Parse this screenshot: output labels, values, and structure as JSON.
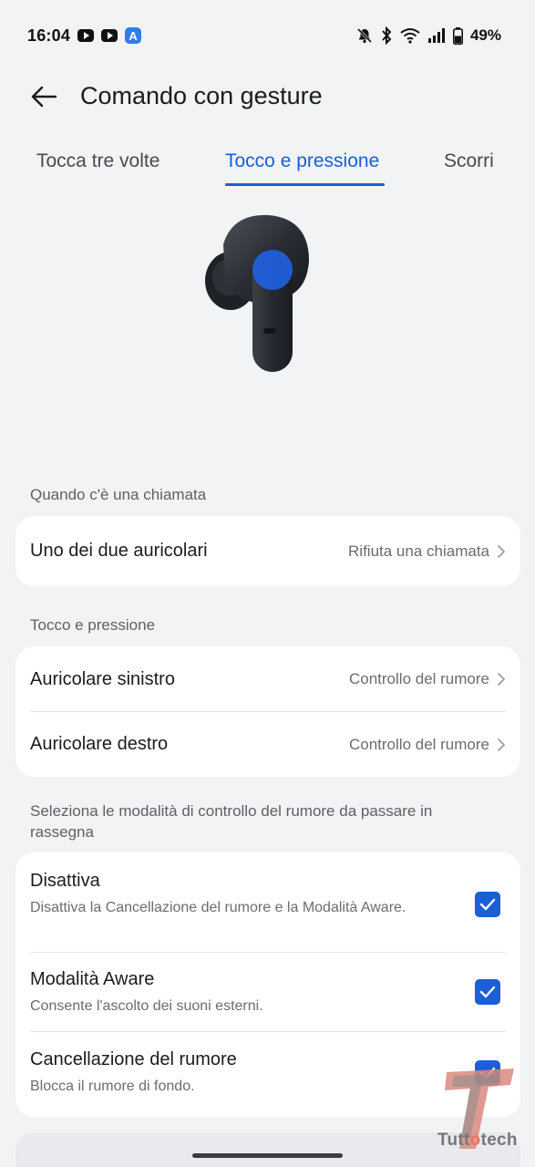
{
  "status_bar": {
    "time": "16:04",
    "battery": "49%",
    "app_icons": [
      "youtube-icon",
      "youtube-icon",
      "a-app-icon"
    ],
    "system_icons": [
      "mute-bell-icon",
      "bluetooth-icon",
      "wifi-icon",
      "signal-icon",
      "battery-icon"
    ]
  },
  "header": {
    "title": "Comando con gesture",
    "back_icon": "back-arrow-icon"
  },
  "tabs": [
    {
      "label": "Tocca tre volte",
      "active": false
    },
    {
      "label": "Tocco e pressione",
      "active": true
    },
    {
      "label": "Scorri",
      "active": false
    }
  ],
  "call_section": {
    "label": "Quando c'è una chiamata",
    "rows": [
      {
        "title": "Uno dei due auricolari",
        "value": "Rifiuta una chiamata"
      }
    ]
  },
  "press_section": {
    "label": "Tocco e pressione",
    "rows": [
      {
        "title": "Auricolare sinistro",
        "value": "Controllo del rumore"
      },
      {
        "title": "Auricolare destro",
        "value": "Controllo del rumore"
      }
    ]
  },
  "noise_section": {
    "label": "Seleziona le modalità di controllo del rumore da passare in rassegna",
    "items": [
      {
        "title": "Disattiva",
        "subtitle": "Disattiva la Cancellazione del rumore e la Modalità Aware.",
        "checked": true
      },
      {
        "title": "Modalità Aware",
        "subtitle": "Consente l'ascolto dei suoni esterni.",
        "checked": true
      },
      {
        "title": "Cancellazione del rumore",
        "subtitle": "Blocca il rumore di fondo.",
        "checked": true
      }
    ]
  },
  "watermark": {
    "brand_prefix": "Tutt",
    "brand_accent": "o",
    "brand_suffix": "tech"
  },
  "colors": {
    "accent": "#1a5fd6",
    "background": "#f1f3f5",
    "card": "#ffffff"
  }
}
